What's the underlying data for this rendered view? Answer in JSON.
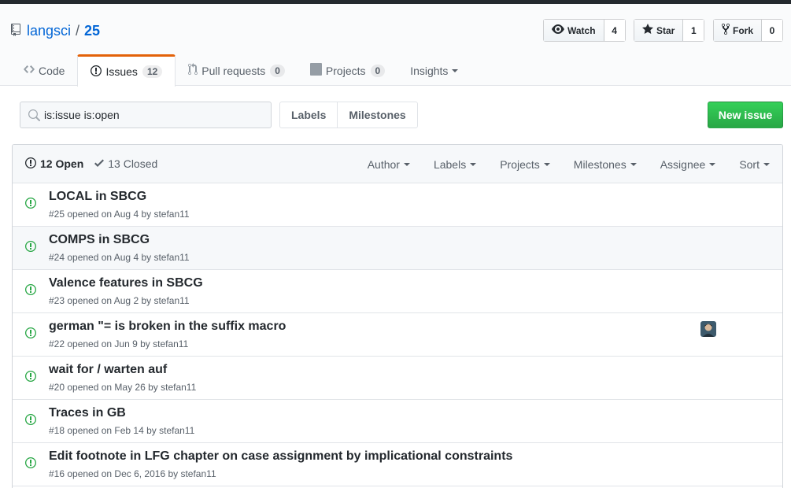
{
  "repo": {
    "owner": "langsci",
    "separator": "/",
    "name": "25"
  },
  "actions": {
    "watch": {
      "label": "Watch",
      "count": "4"
    },
    "star": {
      "label": "Star",
      "count": "1"
    },
    "fork": {
      "label": "Fork",
      "count": "0"
    }
  },
  "nav": {
    "code": {
      "label": "Code"
    },
    "issues": {
      "label": "Issues",
      "count": "12"
    },
    "pulls": {
      "label": "Pull requests",
      "count": "0"
    },
    "projects": {
      "label": "Projects",
      "count": "0"
    },
    "insights": {
      "label": "Insights"
    }
  },
  "search": {
    "value": "is:issue is:open"
  },
  "subnav": {
    "labels": "Labels",
    "milestones": "Milestones"
  },
  "new_issue": "New issue",
  "header": {
    "open": "12 Open",
    "closed": "13 Closed",
    "filters": [
      "Author",
      "Labels",
      "Projects",
      "Milestones",
      "Assignee",
      "Sort"
    ]
  },
  "issues": [
    {
      "title": "LOCAL in SBCG",
      "meta": "#25 opened on Aug 4 by stefan11",
      "has_avatar": false
    },
    {
      "title": "COMPS in SBCG",
      "meta": "#24 opened on Aug 4 by stefan11",
      "has_avatar": false
    },
    {
      "title": "Valence features in SBCG",
      "meta": "#23 opened on Aug 2 by stefan11",
      "has_avatar": false
    },
    {
      "title": "german \"= is broken in the suffix macro",
      "meta": "#22 opened on Jun 9 by stefan11",
      "has_avatar": true
    },
    {
      "title": "wait for / warten auf",
      "meta": "#20 opened on May 26 by stefan11",
      "has_avatar": false
    },
    {
      "title": "Traces in GB",
      "meta": "#18 opened on Feb 14 by stefan11",
      "has_avatar": false
    },
    {
      "title": "Edit footnote in LFG chapter on case assignment by implicational constraints",
      "meta": "#16 opened on Dec 6, 2016 by stefan11",
      "has_avatar": false
    }
  ],
  "colors": {
    "open_green": "#28a745",
    "link_blue": "#0366d6",
    "tab_accent": "#e36209"
  }
}
